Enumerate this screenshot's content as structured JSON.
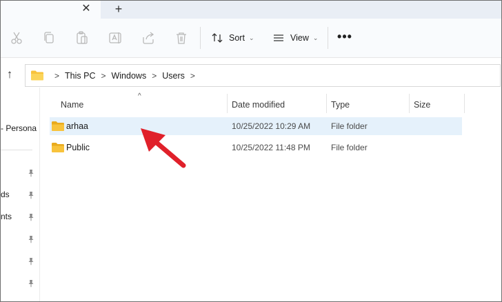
{
  "tabs": {
    "close_glyph": "✕",
    "new_glyph": "+"
  },
  "toolbar": {
    "icons": [
      "cut-icon",
      "copy-icon",
      "paste-icon",
      "rename-icon",
      "share-icon",
      "delete-icon"
    ],
    "sort_label": "Sort",
    "view_label": "View",
    "more_glyph": "•••"
  },
  "address": {
    "crumbs": [
      "This PC",
      "Windows",
      "Users"
    ],
    "separator": ">"
  },
  "nav": {
    "personal_label": "- Persona",
    "items": [
      "ds",
      "nts"
    ]
  },
  "columns": {
    "name": "Name",
    "date_modified": "Date modified",
    "type": "Type",
    "size": "Size"
  },
  "rows": [
    {
      "name": "arhaa",
      "date": "10/25/2022 10:29 AM",
      "type": "File folder",
      "selected": true
    },
    {
      "name": "Public",
      "date": "10/25/2022 11:48 PM",
      "type": "File folder",
      "selected": false
    }
  ],
  "colors": {
    "folder": "#f8c33c",
    "selection": "#e5f1fb",
    "annotation_arrow": "#e0202a"
  }
}
